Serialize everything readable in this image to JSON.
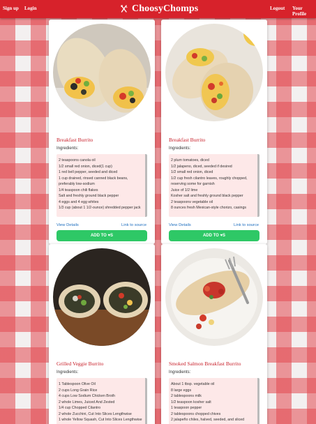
{
  "nav": {
    "signup": "Sign up",
    "login": "Login",
    "brand": "ChoosyChomps",
    "logout": "Logout",
    "profile": "Your Profile"
  },
  "colors": {
    "brand_red": "#d7222b",
    "button_green": "#2ec866",
    "title_red": "#c8202a",
    "link_blue": "#1f6fbf"
  },
  "cards": [
    {
      "title": "Breakfast Burrito",
      "ingredients_label": "Ingredients:",
      "ingredients": [
        "2 teaspoons canola oil",
        "1/2 small red onion, diced(1 cup)",
        "1 red bell pepper, seeded and diced",
        "1 cup drained, rinsed canned black beans,",
        "preferably low-sodium",
        "1/4 teaspoon chili flakes",
        "Salt and freshly ground black pepper",
        "4 eggs and 4 egg whites",
        "1/3 cup (about 1 1/2-ounce) shredded pepper jack"
      ],
      "view_details": "View Details",
      "link_to_source": "Link to source",
      "add_button": "ADD TO ♥S"
    },
    {
      "title": "Breakfast Burrito",
      "ingredients_label": "Ingredients:",
      "ingredients": [
        "2 plum tomatoes, diced",
        "1/2 jalapeno, diced, seeded if desired",
        "1/2 small red onion, diced",
        "1/2 cup fresh cilantro leaves, roughly chopped,",
        "reserving some for garnish",
        "Juice of 1/2 lime",
        "Kosher salt and freshly ground black pepper",
        "2 teaspoons vegetable oil",
        "8 ounces fresh Mexican-style chorizo, casings"
      ],
      "view_details": "View Details",
      "link_to_source": "Link to source",
      "add_button": "ADD TO ♥S"
    },
    {
      "title": "Grilled Veggie Burrito",
      "ingredients_label": "Ingredients:",
      "ingredients": [
        "1 Tablespoon Olive Oil",
        "2 cups Long Grain Rice",
        "4 cups Low Sodium Chicken Broth",
        "2 whole Limes, Juiced And Zested",
        "1/4 cup Chopped Cilantro",
        "2 whole Zucchini, Cut Into Slices Lengthwise",
        "1 whole Yellow Squash, Cut Into Slices Lengthwise"
      ]
    },
    {
      "title": "Smoked Salmon Breakfast Burrito",
      "ingredients_label": "Ingredients:",
      "ingredients": [
        "About 1 tbsp. vegetable oil",
        "8 large eggs",
        "2 tablespoons milk",
        "1/2 teaspoon kosher salt",
        "1 teaspoon pepper",
        "2 tablespoons chopped chives",
        "2 jalapeño chiles, halved, seeded, and sliced"
      ]
    }
  ]
}
